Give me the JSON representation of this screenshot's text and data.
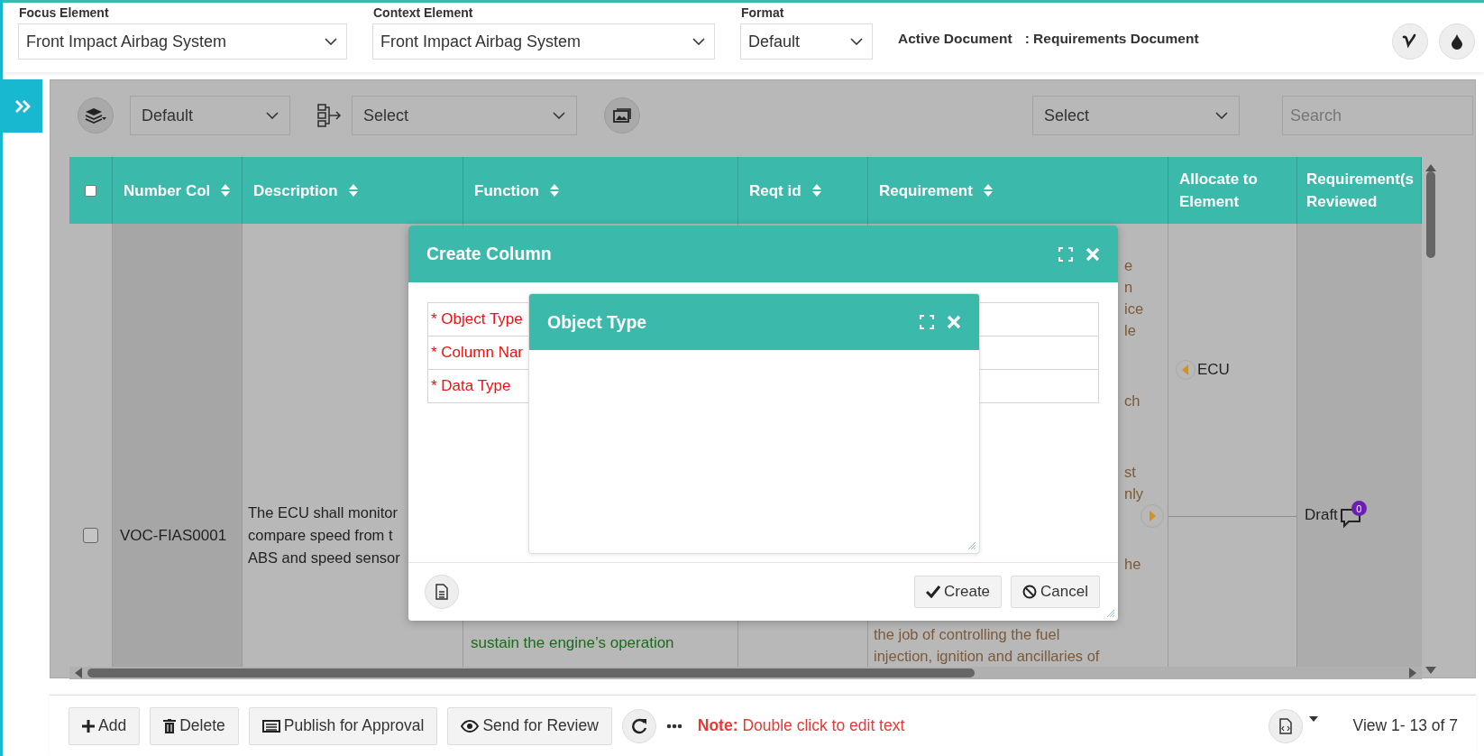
{
  "header": {
    "fields": [
      {
        "label": "Focus Element",
        "value": "Front Impact Airbag System"
      },
      {
        "label": "Context Element",
        "value": "Front Impact Airbag System"
      },
      {
        "label": "Format",
        "value": "Default"
      }
    ],
    "active_document": {
      "label": "Active Document",
      "value": ": Requirements Document"
    }
  },
  "toolbar": {
    "view_select": "Default",
    "hierarchy_select": "Select",
    "filter_select": "Select",
    "search": {
      "placeholder": "Search"
    }
  },
  "table": {
    "all_selected": false,
    "columns": [
      {
        "label": "Number Col",
        "sortable": true
      },
      {
        "label": "Description",
        "sortable": true
      },
      {
        "label": "Function",
        "sortable": true
      },
      {
        "label": "Reqt id",
        "sortable": true
      },
      {
        "label": "Requirement",
        "sortable": true
      },
      {
        "label": "Allocate to Element",
        "sortable": false
      },
      {
        "label": "Requirement(s Reviewed",
        "sortable": false
      }
    ],
    "rows": [
      {
        "selected": false,
        "number": "VOC-FIAS0001",
        "description": [
          "The ECU shall monitor",
          "compare speed from t",
          "ABS and speed sensor"
        ],
        "function": [
          "sustain the engine’s operation"
        ],
        "requirement": [
          {
            "kind": "fragment",
            "lines": [
              "e",
              "n",
              "ice",
              "le"
            ]
          },
          {
            "kind": "fragment",
            "lines": [
              "ch"
            ]
          },
          {
            "kind": "fragment",
            "lines": [
              "st",
              "nly"
            ]
          },
          {
            "kind": "fragment",
            "lines": [
              "he"
            ]
          },
          {
            "kind": "line",
            "lines": [
              "the job of controlling the fuel",
              "injection, ignition and ancillaries of"
            ]
          }
        ],
        "allocations": [
          {
            "text": "ECU"
          }
        ],
        "status": "Draft",
        "comment_count": "0"
      }
    ]
  },
  "dialog": {
    "title": "Create Column",
    "fields": [
      "* Object Type",
      "* Column Nar",
      "* Data Type"
    ],
    "buttons": [
      {
        "kind": "create",
        "label": "Create"
      },
      {
        "kind": "cancel",
        "label": "Cancel"
      }
    ],
    "child": {
      "title": "Object Type"
    }
  },
  "footer": {
    "buttons": [
      {
        "kind": "add",
        "label": "Add"
      },
      {
        "kind": "delete",
        "label": "Delete"
      },
      {
        "kind": "publish",
        "label": "Publish for Approval"
      },
      {
        "kind": "review",
        "label": "Send for Review"
      }
    ],
    "note": "**Note:** Double click to edit text",
    "pager": "View 1- 13 of 7"
  }
}
